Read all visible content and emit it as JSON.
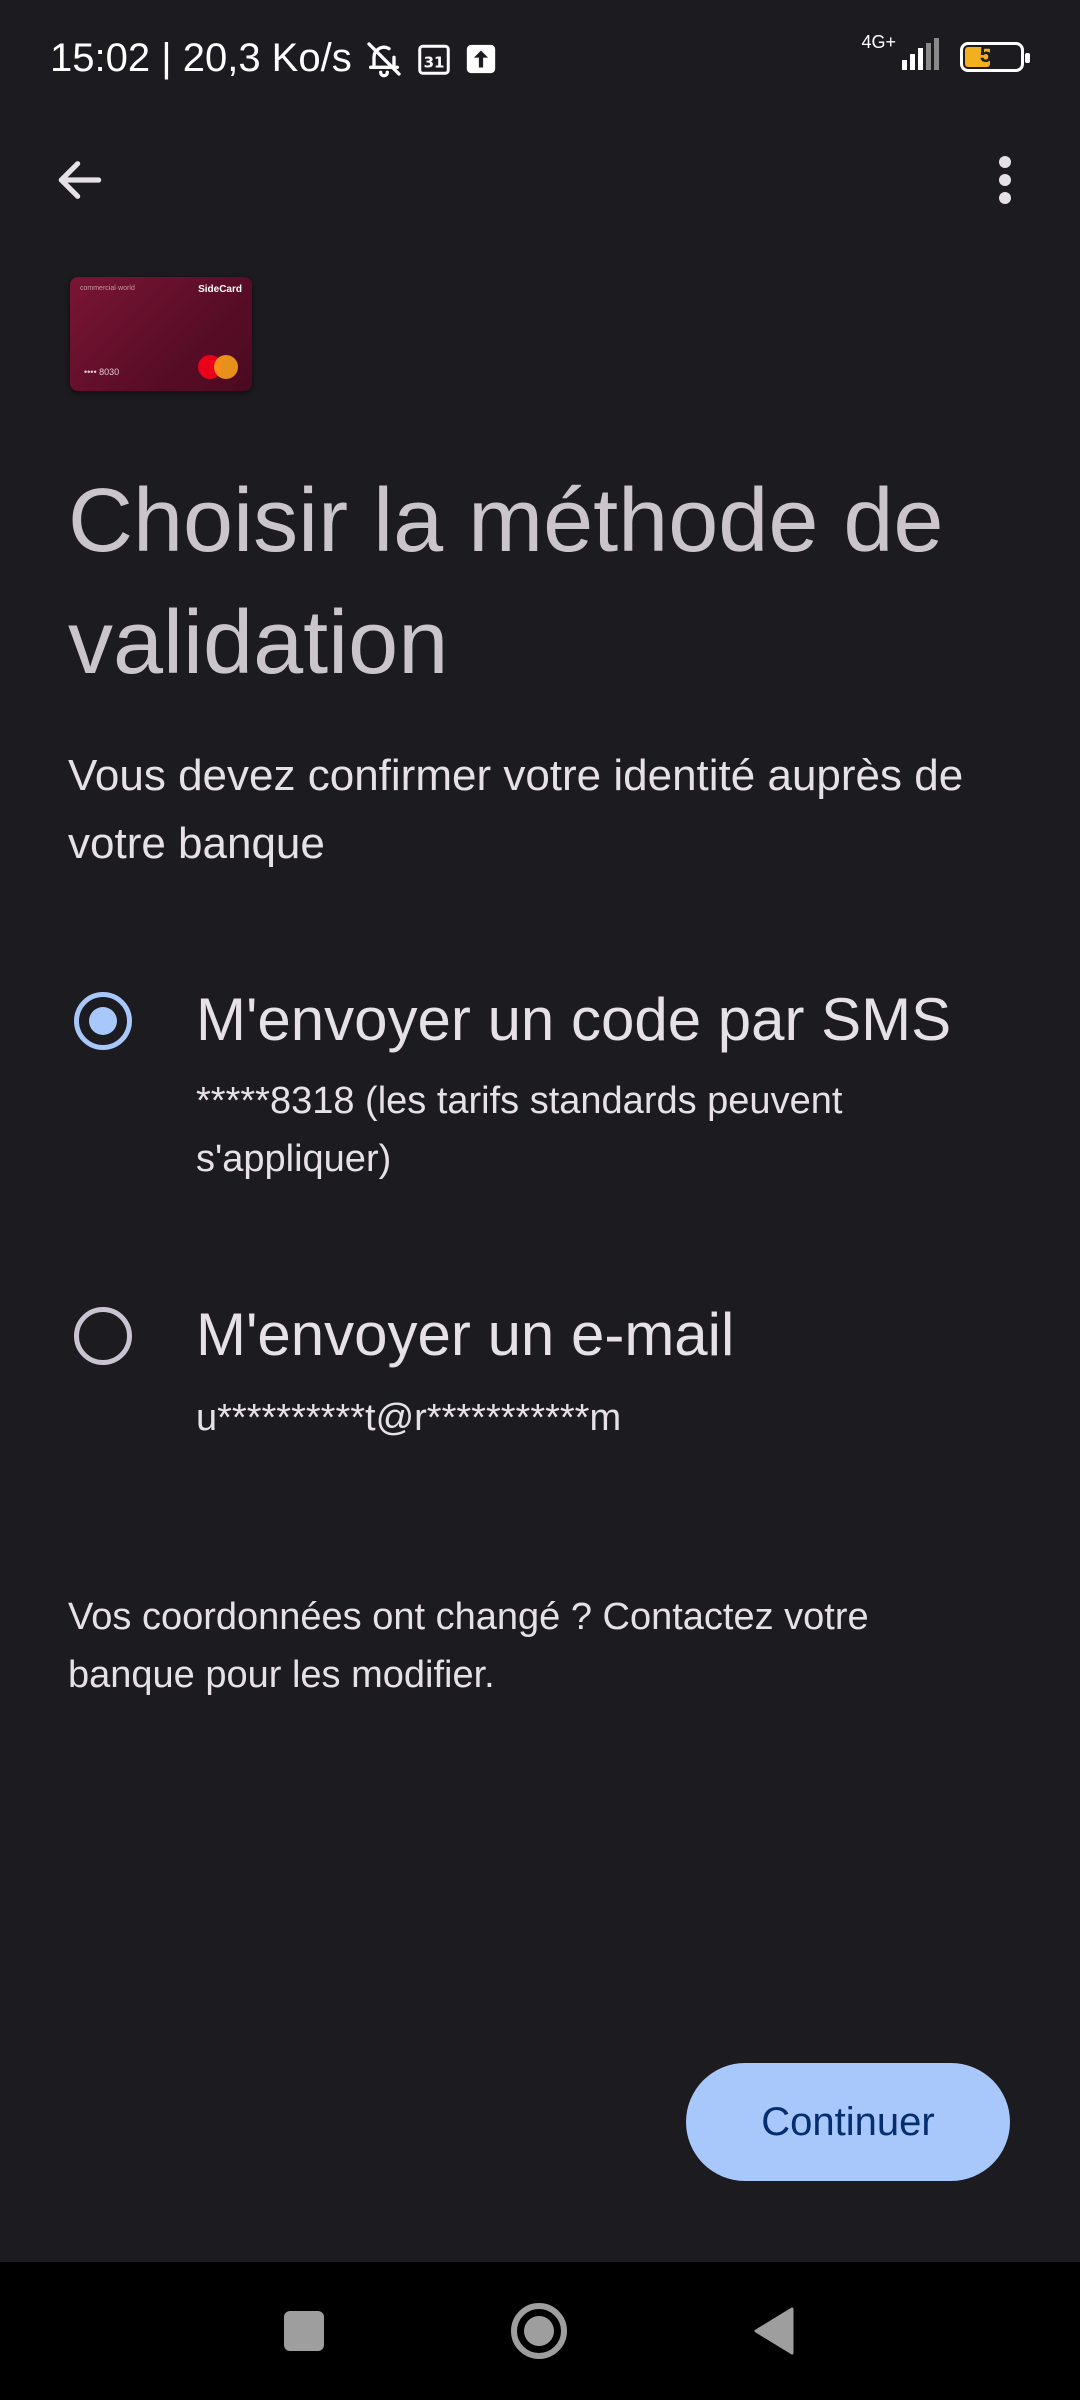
{
  "status_bar": {
    "time_and_speed": "15:02 | 20,3 Ko/s",
    "calendar_day": "31",
    "network": "4G+",
    "battery_level": "50",
    "battery_fraction": 0.5
  },
  "app_bar": {
    "back_icon": "arrow-left-icon",
    "menu_icon": "more-vert-icon"
  },
  "card": {
    "small_text": "commercial·world",
    "brand": "SideCard",
    "number": "•••• 8030",
    "network_logo": "mastercard-logo"
  },
  "title": "Choisir la méthode de validation",
  "subtitle": "Vous devez confirmer votre identité auprès de votre banque",
  "options": [
    {
      "title": "M'envoyer un code par SMS",
      "description": "*****8318 (les tarifs standards peuvent s'appliquer)",
      "selected": true
    },
    {
      "title": "M'envoyer un e-mail",
      "description": "u**********t@r***********m",
      "selected": false
    }
  ],
  "footer_note": "Vos coordonnées ont changé ? Contactez votre banque pour les modifier.",
  "continue_label": "Continuer",
  "colors": {
    "background": "#1c1b1f",
    "accent": "#a8c7fa",
    "on_accent": "#062e6f",
    "card": "#6b1130"
  },
  "nav_bar": {
    "recents_icon": "square-icon",
    "home_icon": "circle-icon",
    "back_icon": "triangle-back-icon"
  }
}
